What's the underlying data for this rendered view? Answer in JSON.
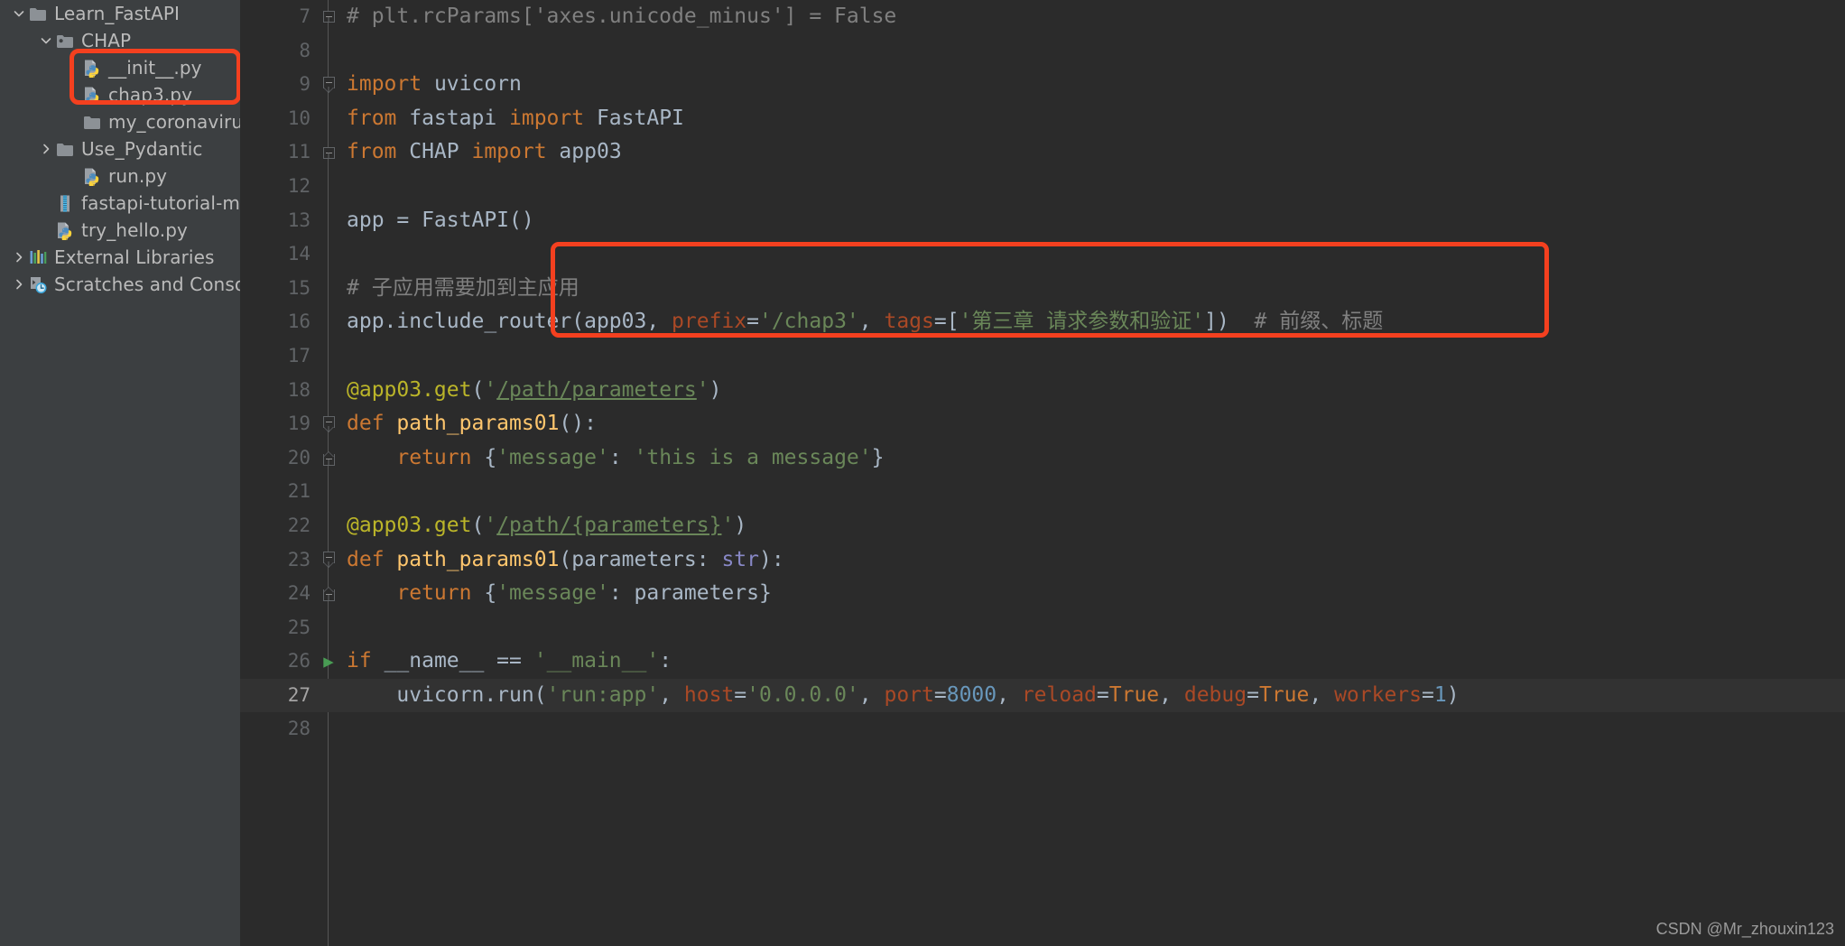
{
  "sidebar": {
    "items": [
      {
        "indent": 0,
        "arrow": "chevron-down",
        "icon": "folder",
        "label": "Learn_FastAPI"
      },
      {
        "indent": 1,
        "arrow": "chevron-down",
        "icon": "folder-module",
        "label": "CHAP"
      },
      {
        "indent": 2,
        "arrow": "none",
        "icon": "python-file",
        "label": "__init__.py"
      },
      {
        "indent": 2,
        "arrow": "none",
        "icon": "python-file",
        "label": "chap3.py"
      },
      {
        "indent": 2,
        "arrow": "none",
        "icon": "folder",
        "label": "my_coronavirus"
      },
      {
        "indent": 1,
        "arrow": "chevron-right",
        "icon": "folder",
        "label": "Use_Pydantic"
      },
      {
        "indent": 2,
        "arrow": "none",
        "icon": "python-file",
        "label": "run.py"
      },
      {
        "indent": 1,
        "arrow": "none",
        "icon": "archive-file",
        "label": "fastapi-tutorial-maste"
      },
      {
        "indent": 1,
        "arrow": "none",
        "icon": "python-file",
        "label": "try_hello.py"
      },
      {
        "indent": 0,
        "arrow": "chevron-right",
        "icon": "libraries",
        "label": "External Libraries"
      },
      {
        "indent": 0,
        "arrow": "chevron-right",
        "icon": "scratches",
        "label": "Scratches and Consoles"
      }
    ]
  },
  "editor": {
    "lines": [
      {
        "no": "7",
        "fold": "fold-start",
        "current": false,
        "run": false,
        "tokens": [
          {
            "t": "# plt.rcParams['axes.unicode_minus'] = False",
            "c": "c-comment"
          }
        ]
      },
      {
        "no": "8",
        "fold": "line",
        "current": false,
        "run": false,
        "tokens": []
      },
      {
        "no": "9",
        "fold": "arrowdown",
        "current": false,
        "run": false,
        "tokens": [
          {
            "t": "import",
            "c": "c-kw"
          },
          {
            "t": " uvicorn",
            "c": "c-plain"
          }
        ]
      },
      {
        "no": "10",
        "fold": "line",
        "current": false,
        "run": false,
        "tokens": [
          {
            "t": "from",
            "c": "c-kw"
          },
          {
            "t": " fastapi ",
            "c": "c-plain"
          },
          {
            "t": "import",
            "c": "c-kw"
          },
          {
            "t": " FastAPI",
            "c": "c-plain"
          }
        ]
      },
      {
        "no": "11",
        "fold": "fold-start",
        "current": false,
        "run": false,
        "tokens": [
          {
            "t": "from",
            "c": "c-kw"
          },
          {
            "t": " CHAP ",
            "c": "c-plain"
          },
          {
            "t": "import",
            "c": "c-kw"
          },
          {
            "t": " app03",
            "c": "c-plain"
          }
        ]
      },
      {
        "no": "12",
        "fold": "none",
        "current": false,
        "run": false,
        "tokens": []
      },
      {
        "no": "13",
        "fold": "none",
        "current": false,
        "run": false,
        "tokens": [
          {
            "t": "app = FastAPI()",
            "c": "c-plain"
          }
        ]
      },
      {
        "no": "14",
        "fold": "none",
        "current": false,
        "run": false,
        "tokens": []
      },
      {
        "no": "15",
        "fold": "none",
        "current": false,
        "run": false,
        "tokens": [
          {
            "t": "# 子应用需要加到主应用",
            "c": "c-comment"
          }
        ]
      },
      {
        "no": "16",
        "fold": "none",
        "current": false,
        "run": false,
        "tokens": [
          {
            "t": "app.include_router(app03, ",
            "c": "c-plain"
          },
          {
            "t": "prefix",
            "c": "c-kwarg"
          },
          {
            "t": "=",
            "c": "c-plain"
          },
          {
            "t": "'/chap3'",
            "c": "c-str"
          },
          {
            "t": ", ",
            "c": "c-plain"
          },
          {
            "t": "tags",
            "c": "c-kwarg"
          },
          {
            "t": "=",
            "c": "c-plain"
          },
          {
            "t": "[",
            "c": "c-plain"
          },
          {
            "t": "'第三章 请求参数和验证'",
            "c": "c-str"
          },
          {
            "t": "])",
            "c": "c-plain"
          },
          {
            "t": "  # 前缀、标题",
            "c": "c-comment"
          }
        ]
      },
      {
        "no": "17",
        "fold": "line",
        "current": false,
        "run": false,
        "tokens": []
      },
      {
        "no": "18",
        "fold": "line",
        "current": false,
        "run": false,
        "tokens": [
          {
            "t": "@app03.get",
            "c": "c-deco"
          },
          {
            "t": "(",
            "c": "c-plain"
          },
          {
            "t": "'",
            "c": "c-str"
          },
          {
            "t": "/path/parameters",
            "c": "c-link"
          },
          {
            "t": "'",
            "c": "c-str"
          },
          {
            "t": ")",
            "c": "c-plain"
          }
        ]
      },
      {
        "no": "19",
        "fold": "arrowdown",
        "current": false,
        "run": false,
        "tokens": [
          {
            "t": "def",
            "c": "c-kw"
          },
          {
            "t": " ",
            "c": "c-plain"
          },
          {
            "t": "path_params01",
            "c": "c-func"
          },
          {
            "t": "():",
            "c": "c-plain"
          }
        ]
      },
      {
        "no": "20",
        "fold": "fold-end",
        "current": false,
        "run": false,
        "tokens": [
          {
            "t": "    ",
            "c": "c-plain"
          },
          {
            "t": "return",
            "c": "c-kw"
          },
          {
            "t": " {",
            "c": "c-plain"
          },
          {
            "t": "'message'",
            "c": "c-str"
          },
          {
            "t": ": ",
            "c": "c-plain"
          },
          {
            "t": "'this is a message'",
            "c": "c-str"
          },
          {
            "t": "}",
            "c": "c-plain"
          }
        ]
      },
      {
        "no": "21",
        "fold": "line",
        "current": false,
        "run": false,
        "tokens": []
      },
      {
        "no": "22",
        "fold": "line",
        "current": false,
        "run": false,
        "tokens": [
          {
            "t": "@app03.get",
            "c": "c-deco"
          },
          {
            "t": "(",
            "c": "c-plain"
          },
          {
            "t": "'",
            "c": "c-str"
          },
          {
            "t": "/path/{parameters}",
            "c": "c-link"
          },
          {
            "t": "'",
            "c": "c-str"
          },
          {
            "t": ")",
            "c": "c-plain"
          }
        ]
      },
      {
        "no": "23",
        "fold": "arrowdown",
        "current": false,
        "run": false,
        "tokens": [
          {
            "t": "def",
            "c": "c-kw"
          },
          {
            "t": " ",
            "c": "c-plain"
          },
          {
            "t": "path_params01",
            "c": "c-func"
          },
          {
            "t": "(parameters: ",
            "c": "c-plain"
          },
          {
            "t": "str",
            "c": "c-builtin"
          },
          {
            "t": "):",
            "c": "c-plain"
          }
        ]
      },
      {
        "no": "24",
        "fold": "fold-end",
        "current": false,
        "run": false,
        "tokens": [
          {
            "t": "    ",
            "c": "c-plain"
          },
          {
            "t": "return",
            "c": "c-kw"
          },
          {
            "t": " {",
            "c": "c-plain"
          },
          {
            "t": "'message'",
            "c": "c-str"
          },
          {
            "t": ": parameters}",
            "c": "c-plain"
          }
        ]
      },
      {
        "no": "25",
        "fold": "none",
        "current": false,
        "run": false,
        "tokens": []
      },
      {
        "no": "26",
        "fold": "none",
        "current": false,
        "run": true,
        "tokens": [
          {
            "t": "if",
            "c": "c-kw"
          },
          {
            "t": " __name__ == ",
            "c": "c-plain"
          },
          {
            "t": "'__main__'",
            "c": "c-str"
          },
          {
            "t": ":",
            "c": "c-plain"
          }
        ]
      },
      {
        "no": "27",
        "fold": "none",
        "current": true,
        "run": false,
        "tokens": [
          {
            "t": "    uvicorn.run(",
            "c": "c-plain"
          },
          {
            "t": "'run:app'",
            "c": "c-str"
          },
          {
            "t": ", ",
            "c": "c-plain"
          },
          {
            "t": "host",
            "c": "c-kwarg"
          },
          {
            "t": "=",
            "c": "c-plain"
          },
          {
            "t": "'0.0.0.0'",
            "c": "c-str"
          },
          {
            "t": ", ",
            "c": "c-plain"
          },
          {
            "t": "port",
            "c": "c-kwarg"
          },
          {
            "t": "=",
            "c": "c-plain"
          },
          {
            "t": "8000",
            "c": "c-num"
          },
          {
            "t": ", ",
            "c": "c-plain"
          },
          {
            "t": "reload",
            "c": "c-kwarg"
          },
          {
            "t": "=",
            "c": "c-plain"
          },
          {
            "t": "True",
            "c": "c-kw"
          },
          {
            "t": ", ",
            "c": "c-plain"
          },
          {
            "t": "debug",
            "c": "c-kwarg"
          },
          {
            "t": "=",
            "c": "c-plain"
          },
          {
            "t": "True",
            "c": "c-kw"
          },
          {
            "t": ", ",
            "c": "c-plain"
          },
          {
            "t": "workers",
            "c": "c-kwarg"
          },
          {
            "t": "=",
            "c": "c-plain"
          },
          {
            "t": "1",
            "c": "c-num"
          },
          {
            "t": ")",
            "c": "c-plain"
          }
        ]
      },
      {
        "no": "28",
        "fold": "none",
        "current": false,
        "run": false,
        "tokens": []
      }
    ]
  },
  "annotations": {
    "files_box_color": "#F4401F",
    "code_box_color": "#F4401F"
  },
  "watermark": {
    "text": "CSDN @Mr_zhouxin123"
  }
}
